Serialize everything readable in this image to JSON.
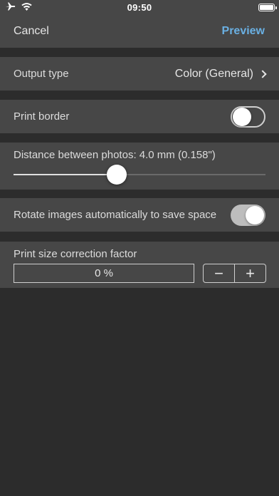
{
  "status": {
    "time": "09:50",
    "airplane_icon": "airplane-icon",
    "wifi_icon": "wifi-icon",
    "battery_icon": "battery-icon"
  },
  "nav": {
    "cancel_label": "Cancel",
    "preview_label": "Preview"
  },
  "output_type": {
    "label": "Output type",
    "value": "Color (General)"
  },
  "print_border": {
    "label": "Print border",
    "enabled": false
  },
  "distance": {
    "label": "Distance between photos: 4.0 mm (0.158\")",
    "slider_fraction": 0.41
  },
  "rotate": {
    "label": "Rotate images automatically to save space",
    "enabled": true
  },
  "correction": {
    "label": "Print size correction factor",
    "value": "0 %",
    "minus_label": "−",
    "plus_label": "+"
  },
  "colors": {
    "accent": "#6ab0e3",
    "cell_bg": "#474747",
    "page_bg": "#2c2c2c"
  }
}
